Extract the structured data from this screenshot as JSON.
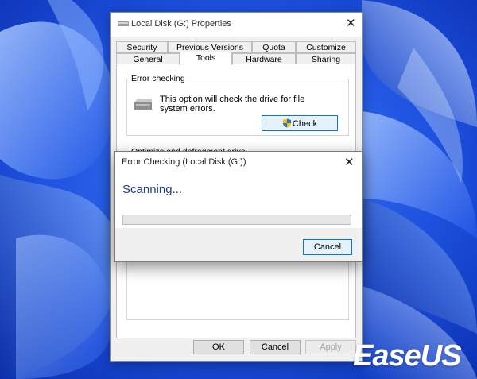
{
  "properties_dialog": {
    "title": "Local Disk (G:) Properties",
    "tabs_row1": [
      "Security",
      "Previous Versions",
      "Quota",
      "Customize"
    ],
    "tabs_row2": [
      "General",
      "Tools",
      "Hardware",
      "Sharing"
    ],
    "active_tab": "Tools",
    "error_checking": {
      "group_title": "Error checking",
      "description_line1": "This option will check the drive for file",
      "description_line2": "system errors.",
      "check_button": "Check"
    },
    "optimize": {
      "group_title": "Optimize and defragment drive"
    },
    "ok_button": "OK",
    "cancel_button": "Cancel",
    "apply_button": "Apply"
  },
  "error_dialog": {
    "title": "Error Checking (Local Disk (G:))",
    "status": "Scanning...",
    "progress_fraction": 0.0,
    "cancel_button": "Cancel"
  },
  "watermark": "EaseUS",
  "colors": {
    "wallpaper_base": "#0a3fd6",
    "accent": "#0078d7",
    "status_text": "#1e3a8a"
  }
}
